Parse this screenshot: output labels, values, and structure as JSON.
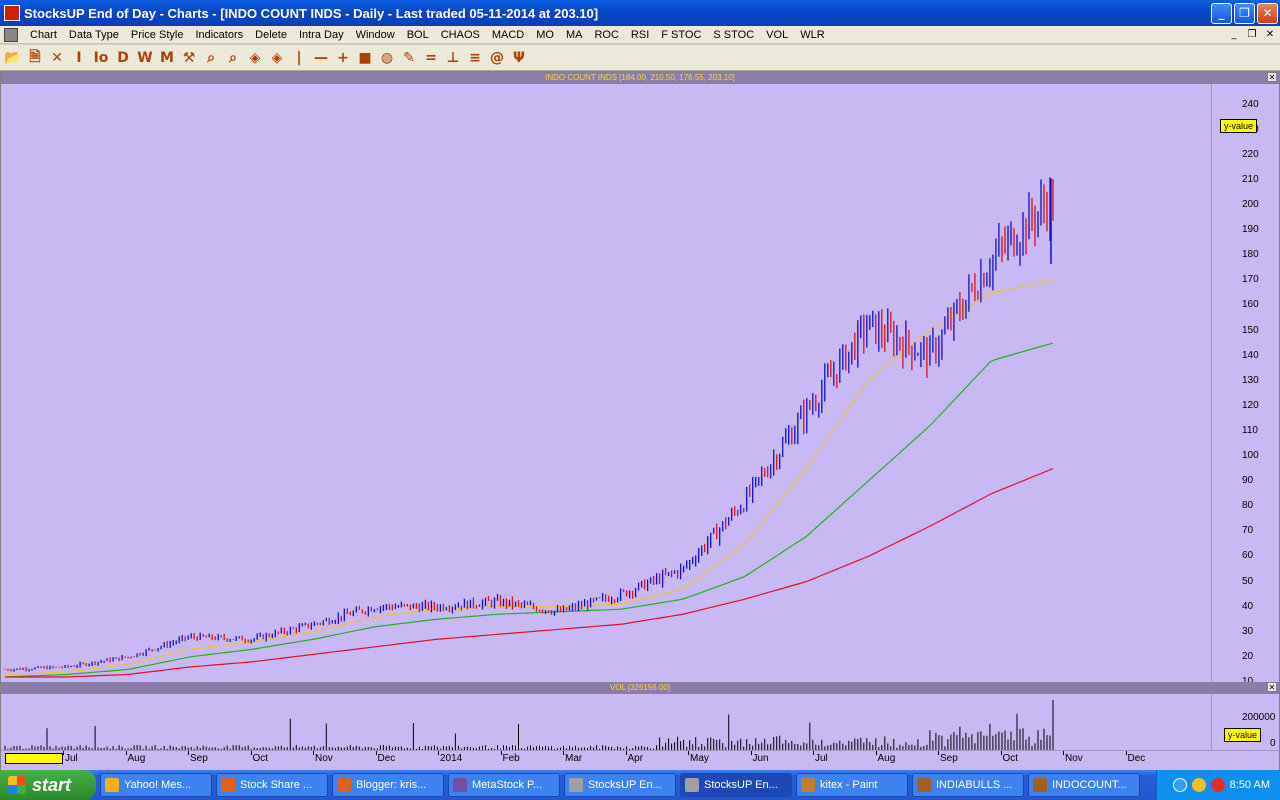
{
  "window": {
    "title": "StocksUP End of Day - Charts - [INDO COUNT INDS - Daily - Last traded 05-11-2014 at 203.10]"
  },
  "menu": [
    "Chart",
    "Data Type",
    "Price Style",
    "Indicators",
    "Delete",
    "Intra Day",
    "Window",
    "BOL",
    "CHAOS",
    "MACD",
    "MO",
    "MA",
    "ROC",
    "RSI",
    "F STOC",
    "S STOC",
    "VOL",
    "WLR"
  ],
  "toolbar": [
    {
      "name": "open-icon",
      "glyph": "📂"
    },
    {
      "name": "new-icon",
      "glyph": "🗎"
    },
    {
      "name": "delete-icon",
      "glyph": "✕"
    },
    {
      "name": "i-icon",
      "glyph": "I"
    },
    {
      "name": "lo-icon",
      "glyph": "Io"
    },
    {
      "name": "d-icon",
      "glyph": "D"
    },
    {
      "name": "w-icon",
      "glyph": "W"
    },
    {
      "name": "m-icon",
      "glyph": "M"
    },
    {
      "name": "hammer-icon",
      "glyph": "⚒"
    },
    {
      "name": "zoom-in-icon",
      "glyph": "⌕"
    },
    {
      "name": "zoom-out-icon",
      "glyph": "⌕"
    },
    {
      "name": "diamond-icon",
      "glyph": "◈"
    },
    {
      "name": "diamond2-icon",
      "glyph": "◈"
    },
    {
      "name": "vline-icon",
      "glyph": "|"
    },
    {
      "name": "hline-icon",
      "glyph": "—"
    },
    {
      "name": "cross-icon",
      "glyph": "+"
    },
    {
      "name": "rect-icon",
      "glyph": "■"
    },
    {
      "name": "globe-icon",
      "glyph": "◍"
    },
    {
      "name": "pen-icon",
      "glyph": "✎"
    },
    {
      "name": "eq-icon",
      "glyph": "="
    },
    {
      "name": "perp-icon",
      "glyph": "⊥"
    },
    {
      "name": "fib-icon",
      "glyph": "≡"
    },
    {
      "name": "at-icon",
      "glyph": "@"
    },
    {
      "name": "psi-icon",
      "glyph": "Ψ"
    }
  ],
  "chart": {
    "header": "INDO COUNT INDS [184.00, 210.50, 176.55, 203.10]",
    "vol_header": "VOL [326156.00]",
    "y_tag": "y-value",
    "vol_tag": "y-value",
    "vol_tick": "200000",
    "vol_zero": "0",
    "y_ticks": [
      "240",
      "230",
      "220",
      "210",
      "200",
      "190",
      "180",
      "170",
      "160",
      "150",
      "140",
      "130",
      "120",
      "110",
      "100",
      "90",
      "80",
      "70",
      "60",
      "50",
      "40",
      "30",
      "20",
      "10"
    ],
    "x_months": [
      "Jul",
      "Aug",
      "Sep",
      "Oct",
      "Nov",
      "Dec",
      "2014",
      "Feb",
      "Mar",
      "Apr",
      "May",
      "Jun",
      "Jul",
      "Aug",
      "Sep",
      "Oct",
      "Nov",
      "Dec"
    ],
    "colors": {
      "up": "#1010d0",
      "down": "#e01010",
      "ma_short": "#f0c040",
      "ma_mid": "#20b020",
      "ma_long": "#e01020",
      "bg": "#c8b8f4"
    }
  },
  "chart_data": {
    "type": "line",
    "title": "INDO COUNT INDS [184.00, 210.50, 176.55, 203.10]",
    "xlabel": "",
    "ylabel": "",
    "ylim": [
      10,
      245
    ],
    "x": [
      "Jun-2013",
      "Jul-2013",
      "Aug-2013",
      "Sep-2013",
      "Oct-2013",
      "Nov-2013",
      "Dec-2013",
      "Jan-2014",
      "Feb-2014",
      "Mar-2014",
      "Apr-2014",
      "May-2014",
      "Jun-2014",
      "Jul-2014",
      "Aug-2014",
      "Sep-2014",
      "Oct-2014",
      "Nov-2014"
    ],
    "series": [
      {
        "name": "close",
        "values": [
          15,
          16,
          20,
          28,
          27,
          33,
          40,
          40,
          42,
          38,
          45,
          55,
          82,
          118,
          152,
          140,
          178,
          203
        ]
      },
      {
        "name": "ma_short",
        "values": [
          13,
          14,
          17,
          23,
          26,
          30,
          36,
          39,
          40,
          40,
          41,
          47,
          65,
          95,
          130,
          150,
          165,
          170
        ]
      },
      {
        "name": "ma_mid",
        "values": [
          12,
          13,
          15,
          20,
          23,
          27,
          32,
          35,
          37,
          38,
          39,
          43,
          52,
          68,
          90,
          112,
          138,
          145
        ]
      },
      {
        "name": "ma_long",
        "values": [
          12,
          12,
          13,
          16,
          18,
          21,
          24,
          27,
          29,
          31,
          33,
          37,
          43,
          50,
          60,
          72,
          85,
          95
        ]
      }
    ],
    "grid": false
  },
  "taskbar": {
    "start": "start",
    "items": [
      "Yahoo! Mes...",
      "Stock Share ...",
      "Blogger: kris...",
      "MetaStock P...",
      "StocksUP En...",
      "StocksUP En...",
      "kitex - Paint",
      "INDIABULLS ...",
      "INDOCOUNT..."
    ],
    "active": 5,
    "clock": "8:50 AM"
  }
}
